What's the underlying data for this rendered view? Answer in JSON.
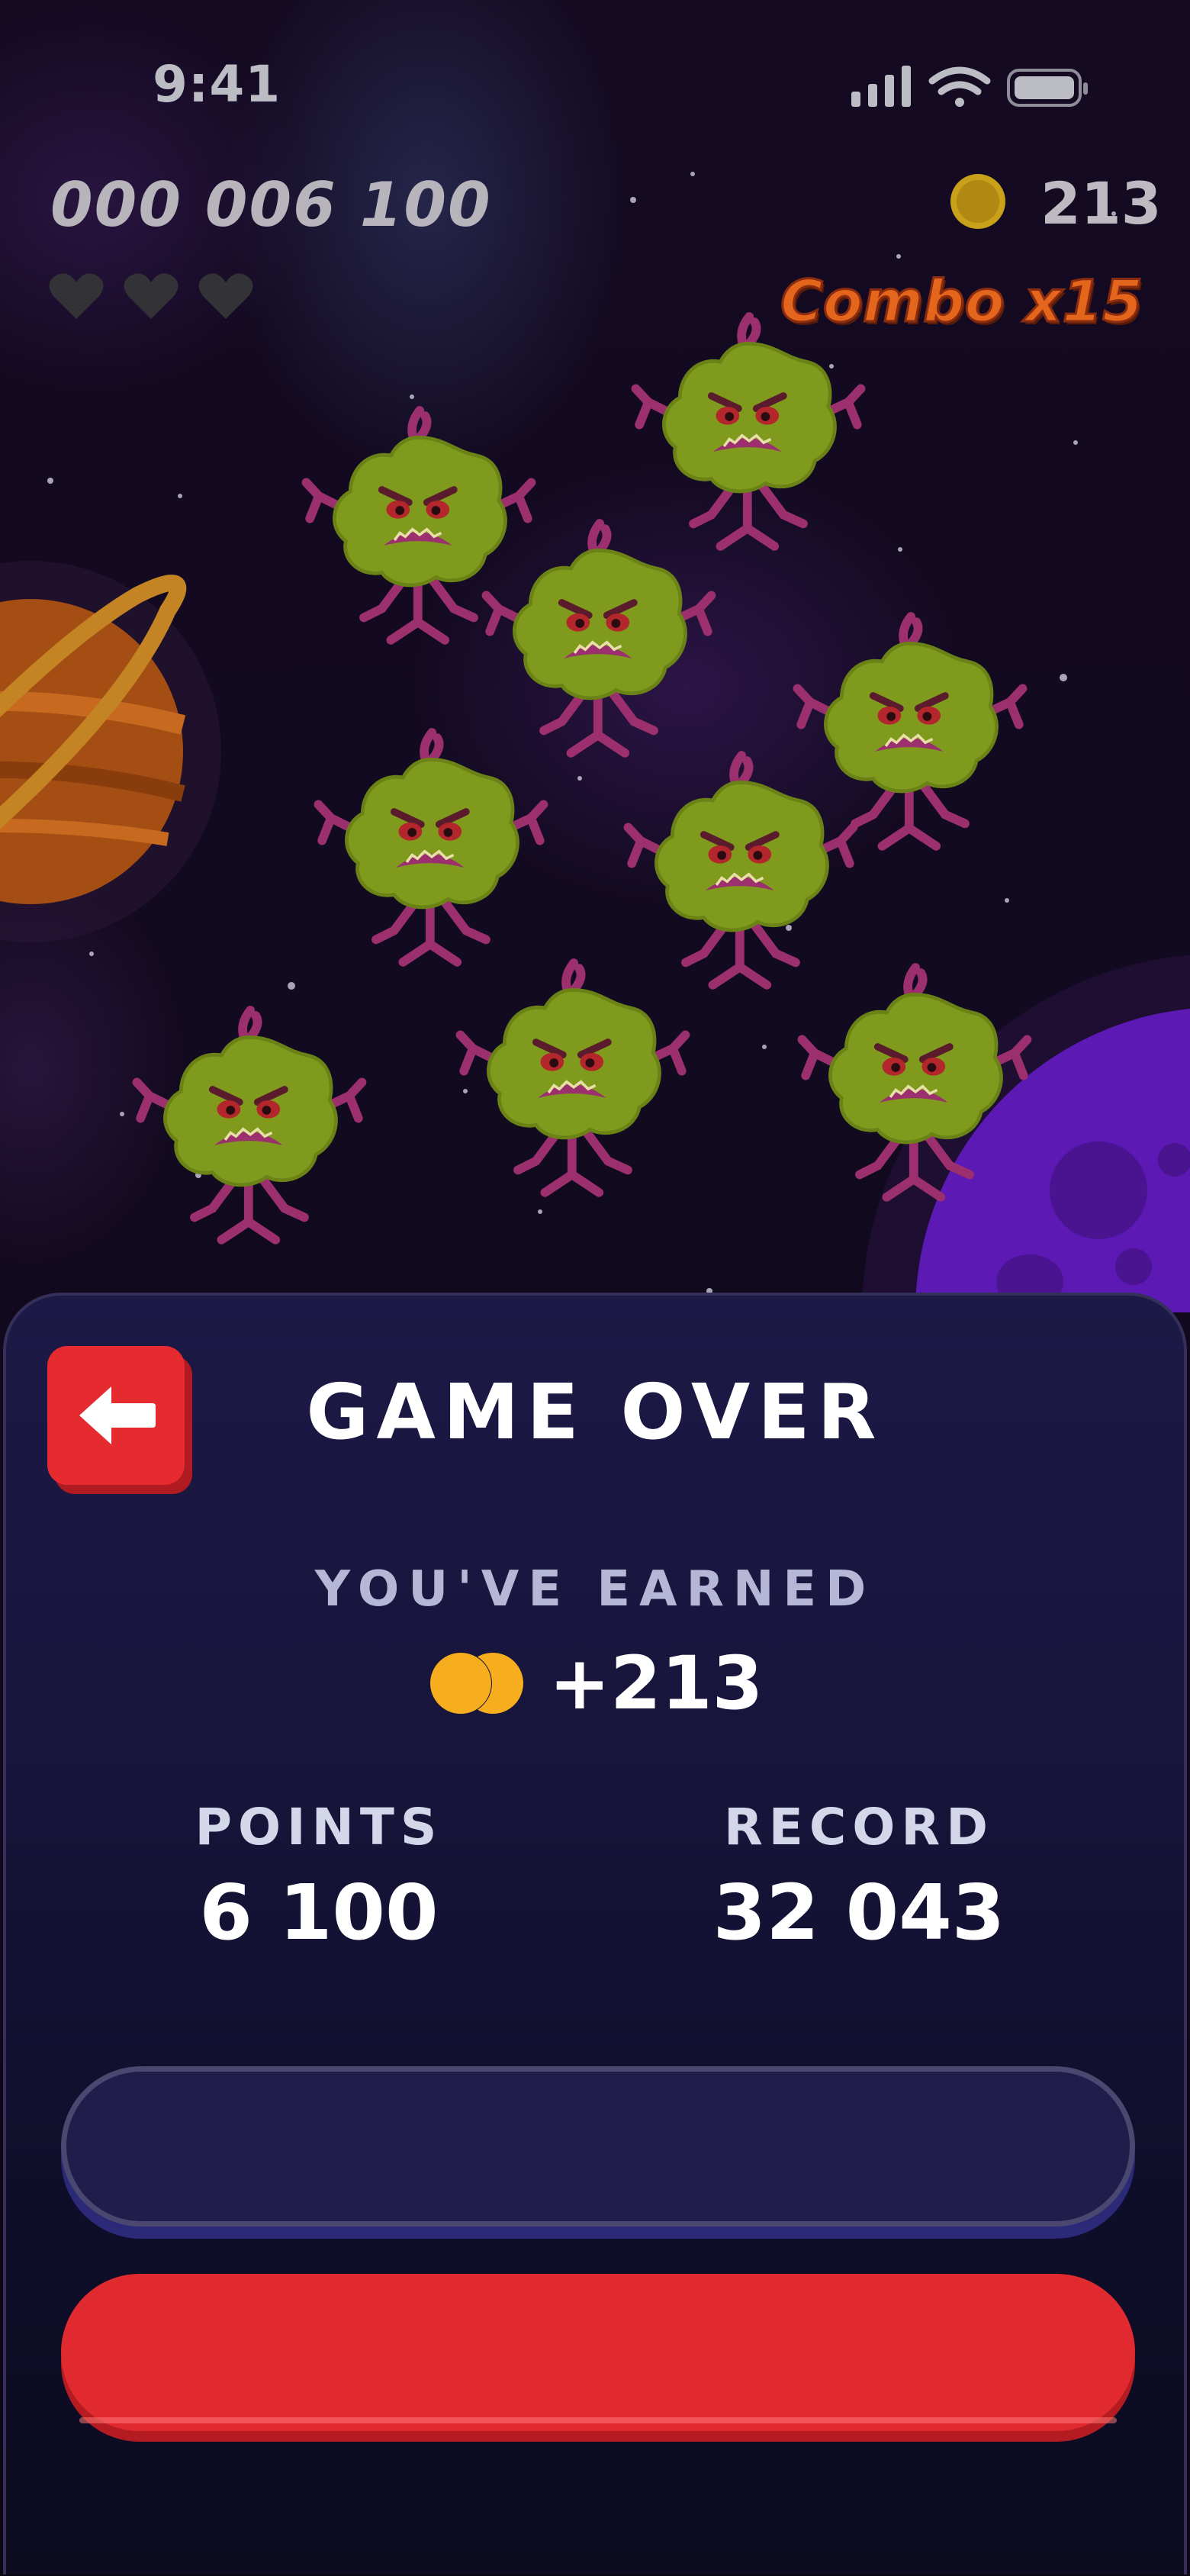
{
  "status_bar": {
    "time": "9:41"
  },
  "hud": {
    "score": "000 006 100",
    "coins": "213",
    "combo": "Combo x15",
    "lives_total": 3,
    "lives_remaining": 0
  },
  "game_over": {
    "title": "GAME OVER",
    "earned_label": "YOU'VE EARNED",
    "earned_value": "+213",
    "points_label": "POINTS",
    "points_value": "6 100",
    "record_label": "RECORD",
    "record_value": "32 043",
    "secondary_button_label": "",
    "primary_button_label": ""
  },
  "colors": {
    "accent_red": "#e52a30",
    "coin_gold": "#f6ae1e",
    "panel_navy": "#1c1946",
    "monster_green": "#7f9a1c",
    "monster_magenta": "#9c2f6e"
  },
  "icons": {
    "back": "arrow-left-icon",
    "heart": "heart-icon",
    "coin": "coin-icon",
    "signal": "cellular-signal-icon",
    "wifi": "wifi-icon",
    "battery": "battery-icon"
  }
}
